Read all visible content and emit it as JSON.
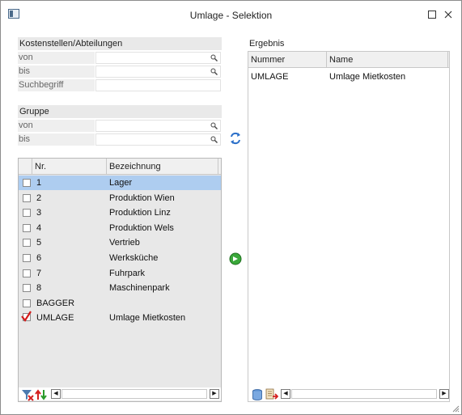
{
  "window": {
    "title": "Umlage - Selektion"
  },
  "kostenstellen": {
    "heading": "Kostenstellen/Abteilungen",
    "fields": [
      {
        "label": "von",
        "value": ""
      },
      {
        "label": "bis",
        "value": ""
      },
      {
        "label": "Suchbegriff",
        "value": ""
      }
    ]
  },
  "gruppe": {
    "heading": "Gruppe",
    "fields": [
      {
        "label": "von",
        "value": ""
      },
      {
        "label": "bis",
        "value": ""
      }
    ]
  },
  "list": {
    "columns": [
      "Nr.",
      "Bezeichnung"
    ],
    "rows": [
      {
        "nr": "1",
        "bez": "Lager",
        "checked": false,
        "selected": true
      },
      {
        "nr": "2",
        "bez": "Produktion Wien",
        "checked": false,
        "selected": false
      },
      {
        "nr": "3",
        "bez": "Produktion Linz",
        "checked": false,
        "selected": false
      },
      {
        "nr": "4",
        "bez": "Produktion Wels",
        "checked": false,
        "selected": false
      },
      {
        "nr": "5",
        "bez": "Vertrieb",
        "checked": false,
        "selected": false
      },
      {
        "nr": "6",
        "bez": "Werksküche",
        "checked": false,
        "selected": false
      },
      {
        "nr": "7",
        "bez": "Fuhrpark",
        "checked": false,
        "selected": false
      },
      {
        "nr": "8",
        "bez": "Maschinenpark",
        "checked": false,
        "selected": false
      },
      {
        "nr": "BAGGER",
        "bez": "",
        "checked": false,
        "selected": false
      },
      {
        "nr": "UMLAGE",
        "bez": "Umlage Mietkosten",
        "checked": true,
        "selected": false
      }
    ]
  },
  "ergebnis": {
    "heading": "Ergebnis",
    "columns": [
      "Nummer",
      "Name"
    ],
    "rows": [
      {
        "nummer": "UMLAGE",
        "name": "Umlage Mietkosten"
      }
    ]
  },
  "icons": {
    "swap": "swap-arrows-icon",
    "transfer": "green-arrow-right-icon",
    "filter_clear": "filter-clear-icon",
    "sort": "sort-arrows-icon",
    "database": "database-icon",
    "export": "export-icon"
  }
}
